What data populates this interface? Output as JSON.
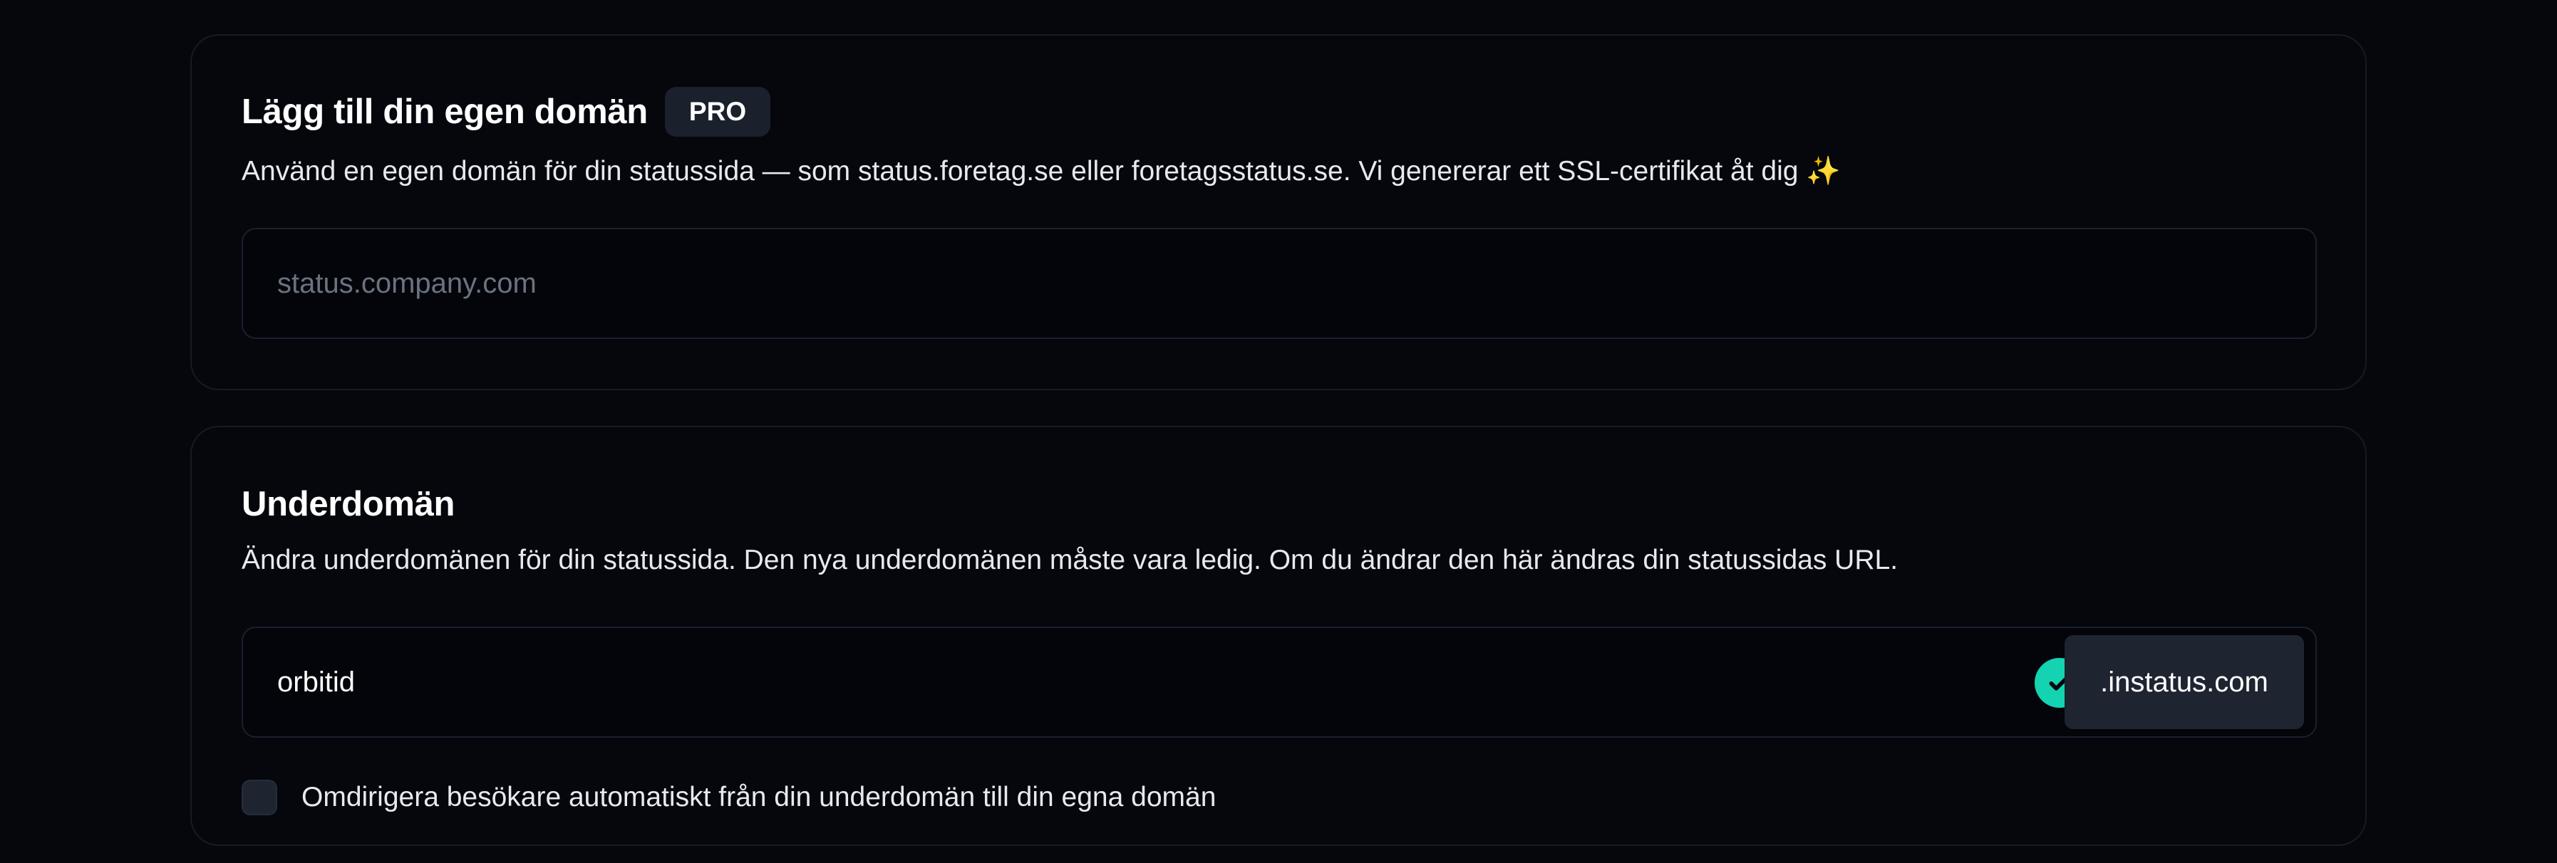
{
  "custom_domain": {
    "title": "Lägg till din egen domän",
    "badge": "PRO",
    "description": "Använd en egen domän för din statussida — som status.foretag.se eller foretagsstatus.se. Vi genererar ett SSL-certifikat åt dig",
    "sparkle": "✨",
    "input_value": "",
    "input_placeholder": "status.company.com"
  },
  "subdomain": {
    "title": "Underdomän",
    "description": "Ändra underdomänen för din statussida. Den nya underdomänen måste vara ledig. Om du ändrar den här ändras din statussidas URL.",
    "input_value": "orbitid",
    "status_icon": "check-circle-icon",
    "status_color": "#14d3b0",
    "suffix": ".instatus.com",
    "redirect_label": "Omdirigera besökare automatiskt från din underdomän till din egna domän",
    "redirect_checked": false
  },
  "colors": {
    "background": "#05070d",
    "card_border": "#161b26",
    "badge_bg": "#1a202c",
    "accent": "#14d3b0"
  }
}
